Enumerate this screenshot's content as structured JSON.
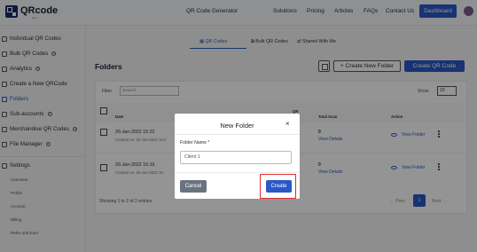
{
  "brand": {
    "name": "QRcode",
    "sub": "Gen"
  },
  "nav": {
    "links": [
      "QR Code Generator",
      "Solutions",
      "Pricing",
      "Articles",
      "FAQs",
      "Contact Us"
    ],
    "dashboard": "Dashboard"
  },
  "sidebar": {
    "items": [
      {
        "label": "Individual QR Codes"
      },
      {
        "label": "Bulk QR Codes"
      },
      {
        "label": "Analytics"
      },
      {
        "label": "Create a New QRCode"
      },
      {
        "label": "Folders"
      },
      {
        "label": "Sub-accounts"
      },
      {
        "label": "Merchandise QR Codes"
      },
      {
        "label": "File Manager"
      }
    ],
    "settings": "Settings",
    "sub_items": [
      "Overview",
      "Profile",
      "Account",
      "Billing",
      "Refer and Earn"
    ]
  },
  "tabs": [
    "QR Codes",
    "Bulk QR Codes",
    "Shared With Me"
  ],
  "page": {
    "title": "Folders",
    "new_folder": "+ Create New Folder",
    "create_qr": "Create QR Code",
    "filter_label": "Filter",
    "filter_placeholder": "Search",
    "show_label": "Show",
    "show_value": "10"
  },
  "table": {
    "headers": {
      "date": "Date",
      "qr_top": "QR",
      "qr_bottom": "Sca",
      "total": "Total Scan",
      "action": "Action"
    },
    "rows": [
      {
        "date": "26-Jan-2022 15:22",
        "created": "Created on: 26-Jan-2022 15:2",
        "total": "0",
        "view_details": "View Details",
        "view_folder": "View Folder"
      },
      {
        "date": "26-Jan-2022 15:19",
        "created": "Created on: 26-Jan-2022 15:",
        "total": "0",
        "view_details": "View Details",
        "view_folder": "View Folder"
      }
    ],
    "footer": "Showing 1 to 2 of 2 entries",
    "prev": "Prev",
    "page": "1",
    "next": "Next"
  },
  "modal": {
    "title": "New Folder",
    "close": "×",
    "field_label": "Folder Name *",
    "field_value": "Client 1",
    "cancel": "Cancel",
    "create": "Create"
  },
  "colors": {
    "accent": "#2a59c6",
    "highlight": "#e22d2d",
    "cancel": "#6b7280"
  }
}
